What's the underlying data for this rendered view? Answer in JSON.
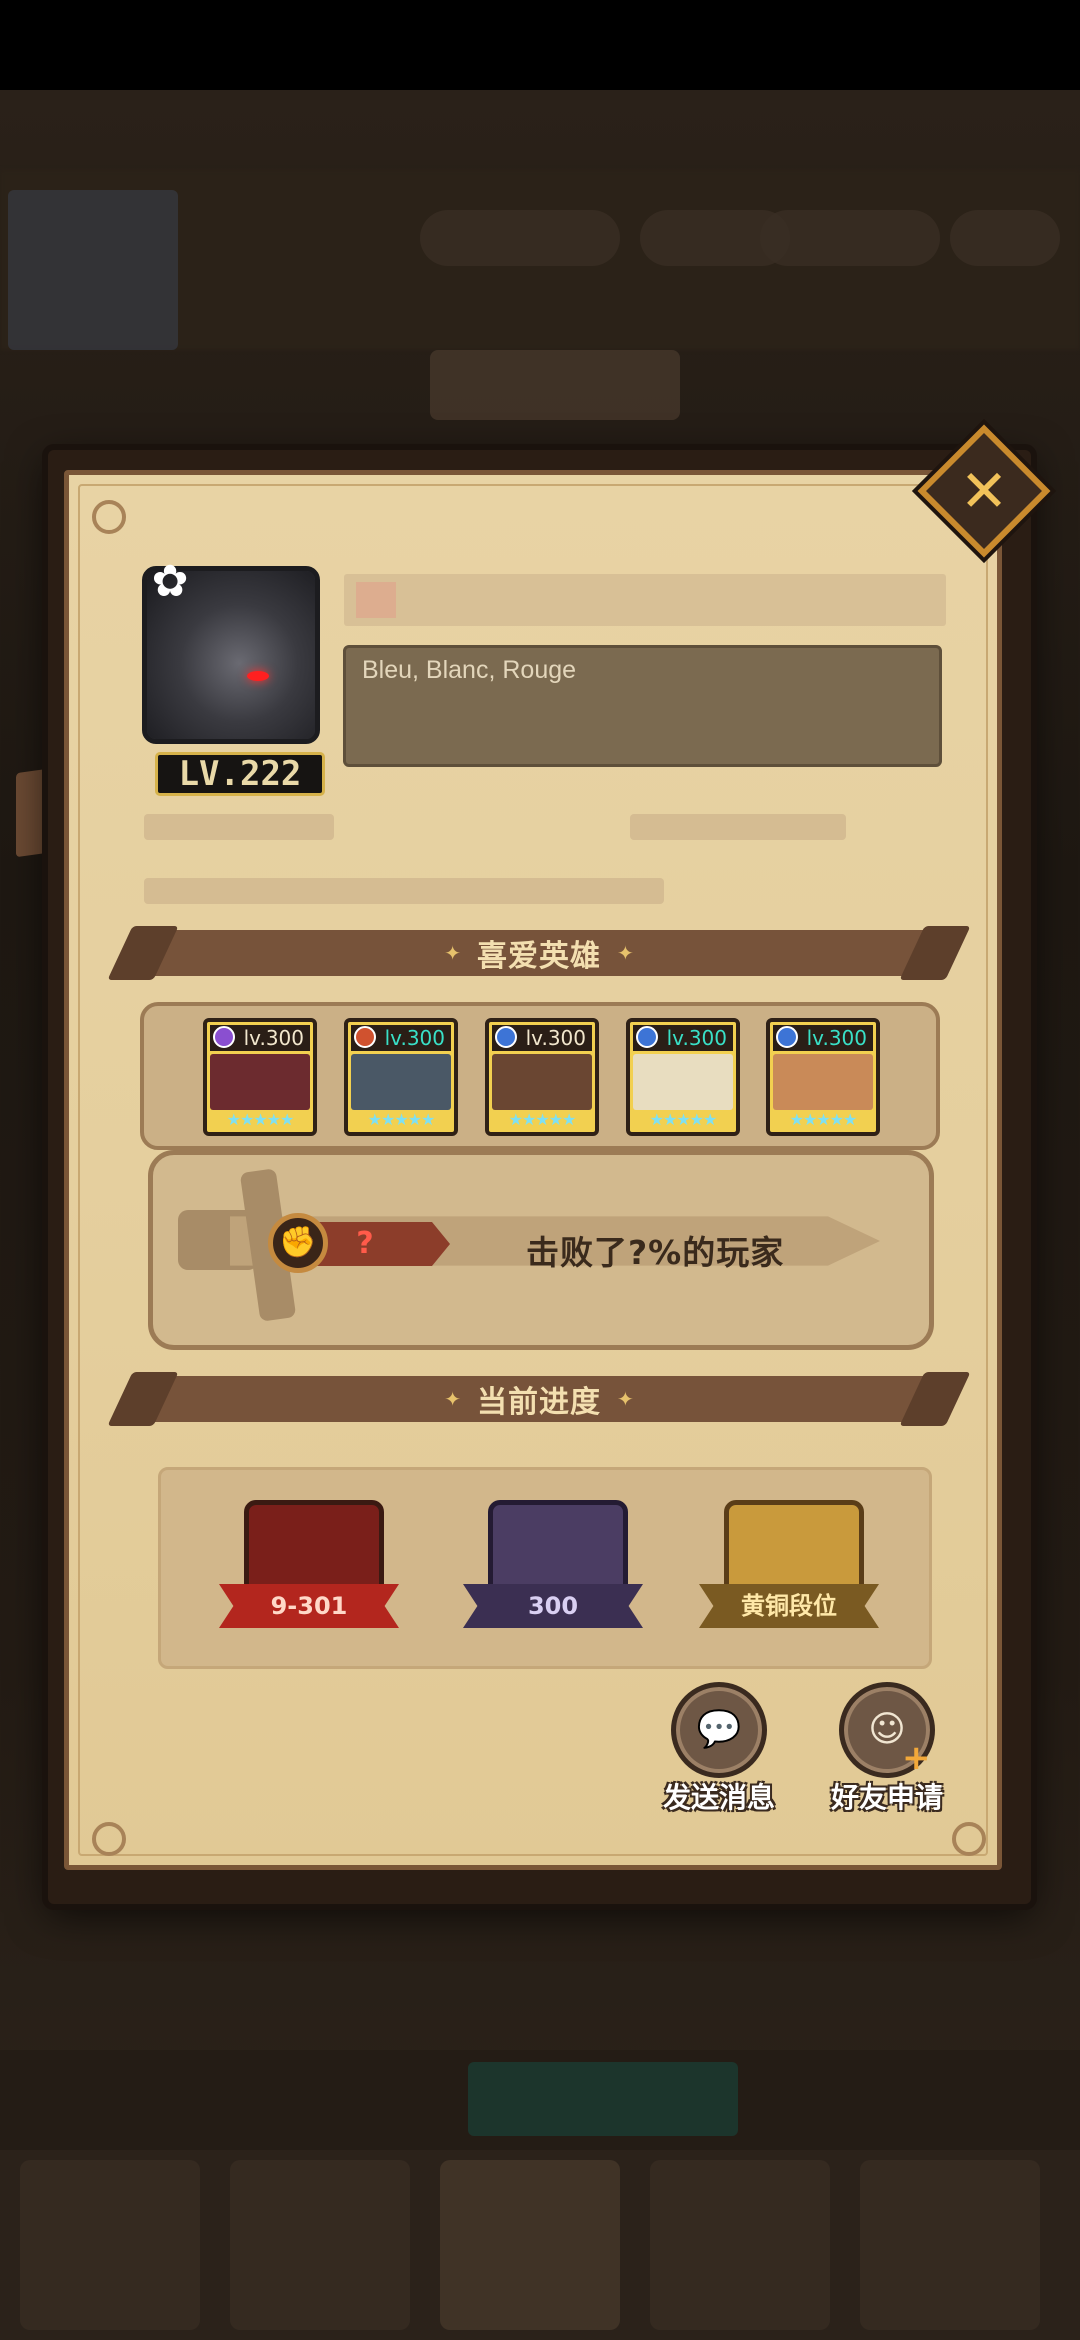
{
  "colors": {
    "panel_bg": "#e5cf9e",
    "banner": "#77533a",
    "lv_badge_border": "#d6b24a",
    "rank_red": "#ff5b4a",
    "close_accent": "#c98a2d"
  },
  "profile": {
    "level": "LV.222",
    "signature": "Bleu, Blanc, Rouge"
  },
  "favorite_heroes": {
    "title": "喜爱英雄",
    "items": [
      {
        "level": "lv.300",
        "element_icon": "purple-gem-icon",
        "element_color": "#8a4fd0",
        "stars": "★★★★★",
        "face_color": "#6c2b2f"
      },
      {
        "level": "lv.300",
        "element_icon": "red-fire-icon",
        "element_color": "#d0522f",
        "stars": "★★★★★",
        "face_color": "#4a5866"
      },
      {
        "level": "lv.300",
        "element_icon": "blue-drop-icon",
        "element_color": "#3d74d6",
        "stars": "★★★★★",
        "face_color": "#6a4632"
      },
      {
        "level": "lv.300",
        "element_icon": "blue-drop-icon",
        "element_color": "#3d74d6",
        "stars": "★★★★★",
        "face_color": "#e8ddc0"
      },
      {
        "level": "lv.300",
        "element_icon": "blue-drop-icon",
        "element_color": "#3d74d6",
        "stars": "★★★★★",
        "face_color": "#c98a58"
      }
    ]
  },
  "rank": {
    "value": "?",
    "text": "击败了?%的玩家",
    "icon": "fist-icon"
  },
  "progress": {
    "title": "当前进度",
    "stage": "9-301",
    "tower": "300",
    "league": "黄铜段位"
  },
  "actions": {
    "send_message": "发送消息",
    "friend_request": "好友申请"
  }
}
